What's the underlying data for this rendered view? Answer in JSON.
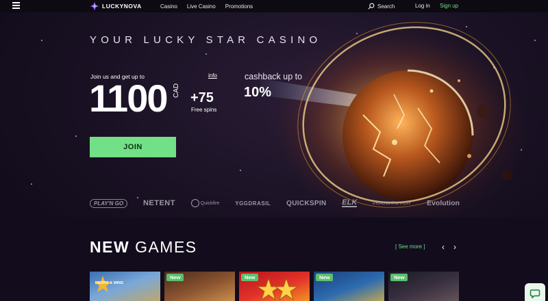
{
  "topbar": {
    "brand": "LUCKYNOVA",
    "nav": [
      "Casino",
      "Live Casino",
      "Promotions"
    ],
    "search_label": "Search",
    "login_label": "Log in",
    "signup_label": "Sign up"
  },
  "hero": {
    "tagline": "YOUR LUCKY STAR CASINO",
    "join_text": "Join us and get up to",
    "info_link": "info",
    "amount": "1100",
    "currency": "CAD",
    "plus_spins": "+75",
    "free_spins_label": "Free spins",
    "cashback_label": "cashback up to",
    "cashback_value": "10%",
    "join_button": "JOIN"
  },
  "providers": [
    "PLAY'N GO",
    "NETENT",
    "Quickfire",
    "YGGDRASIL",
    "QUICKSPIN",
    "ELK",
    "PRAGMATIC PLAY",
    "Evolution"
  ],
  "new_games": {
    "title_bold": "NEW",
    "title_light": "GAMES",
    "see_more": "[ See more ]",
    "badge": "New",
    "card1_text": "DROPS & WINS"
  },
  "colors": {
    "accent_green": "#72e086",
    "background": "#120c1c"
  }
}
